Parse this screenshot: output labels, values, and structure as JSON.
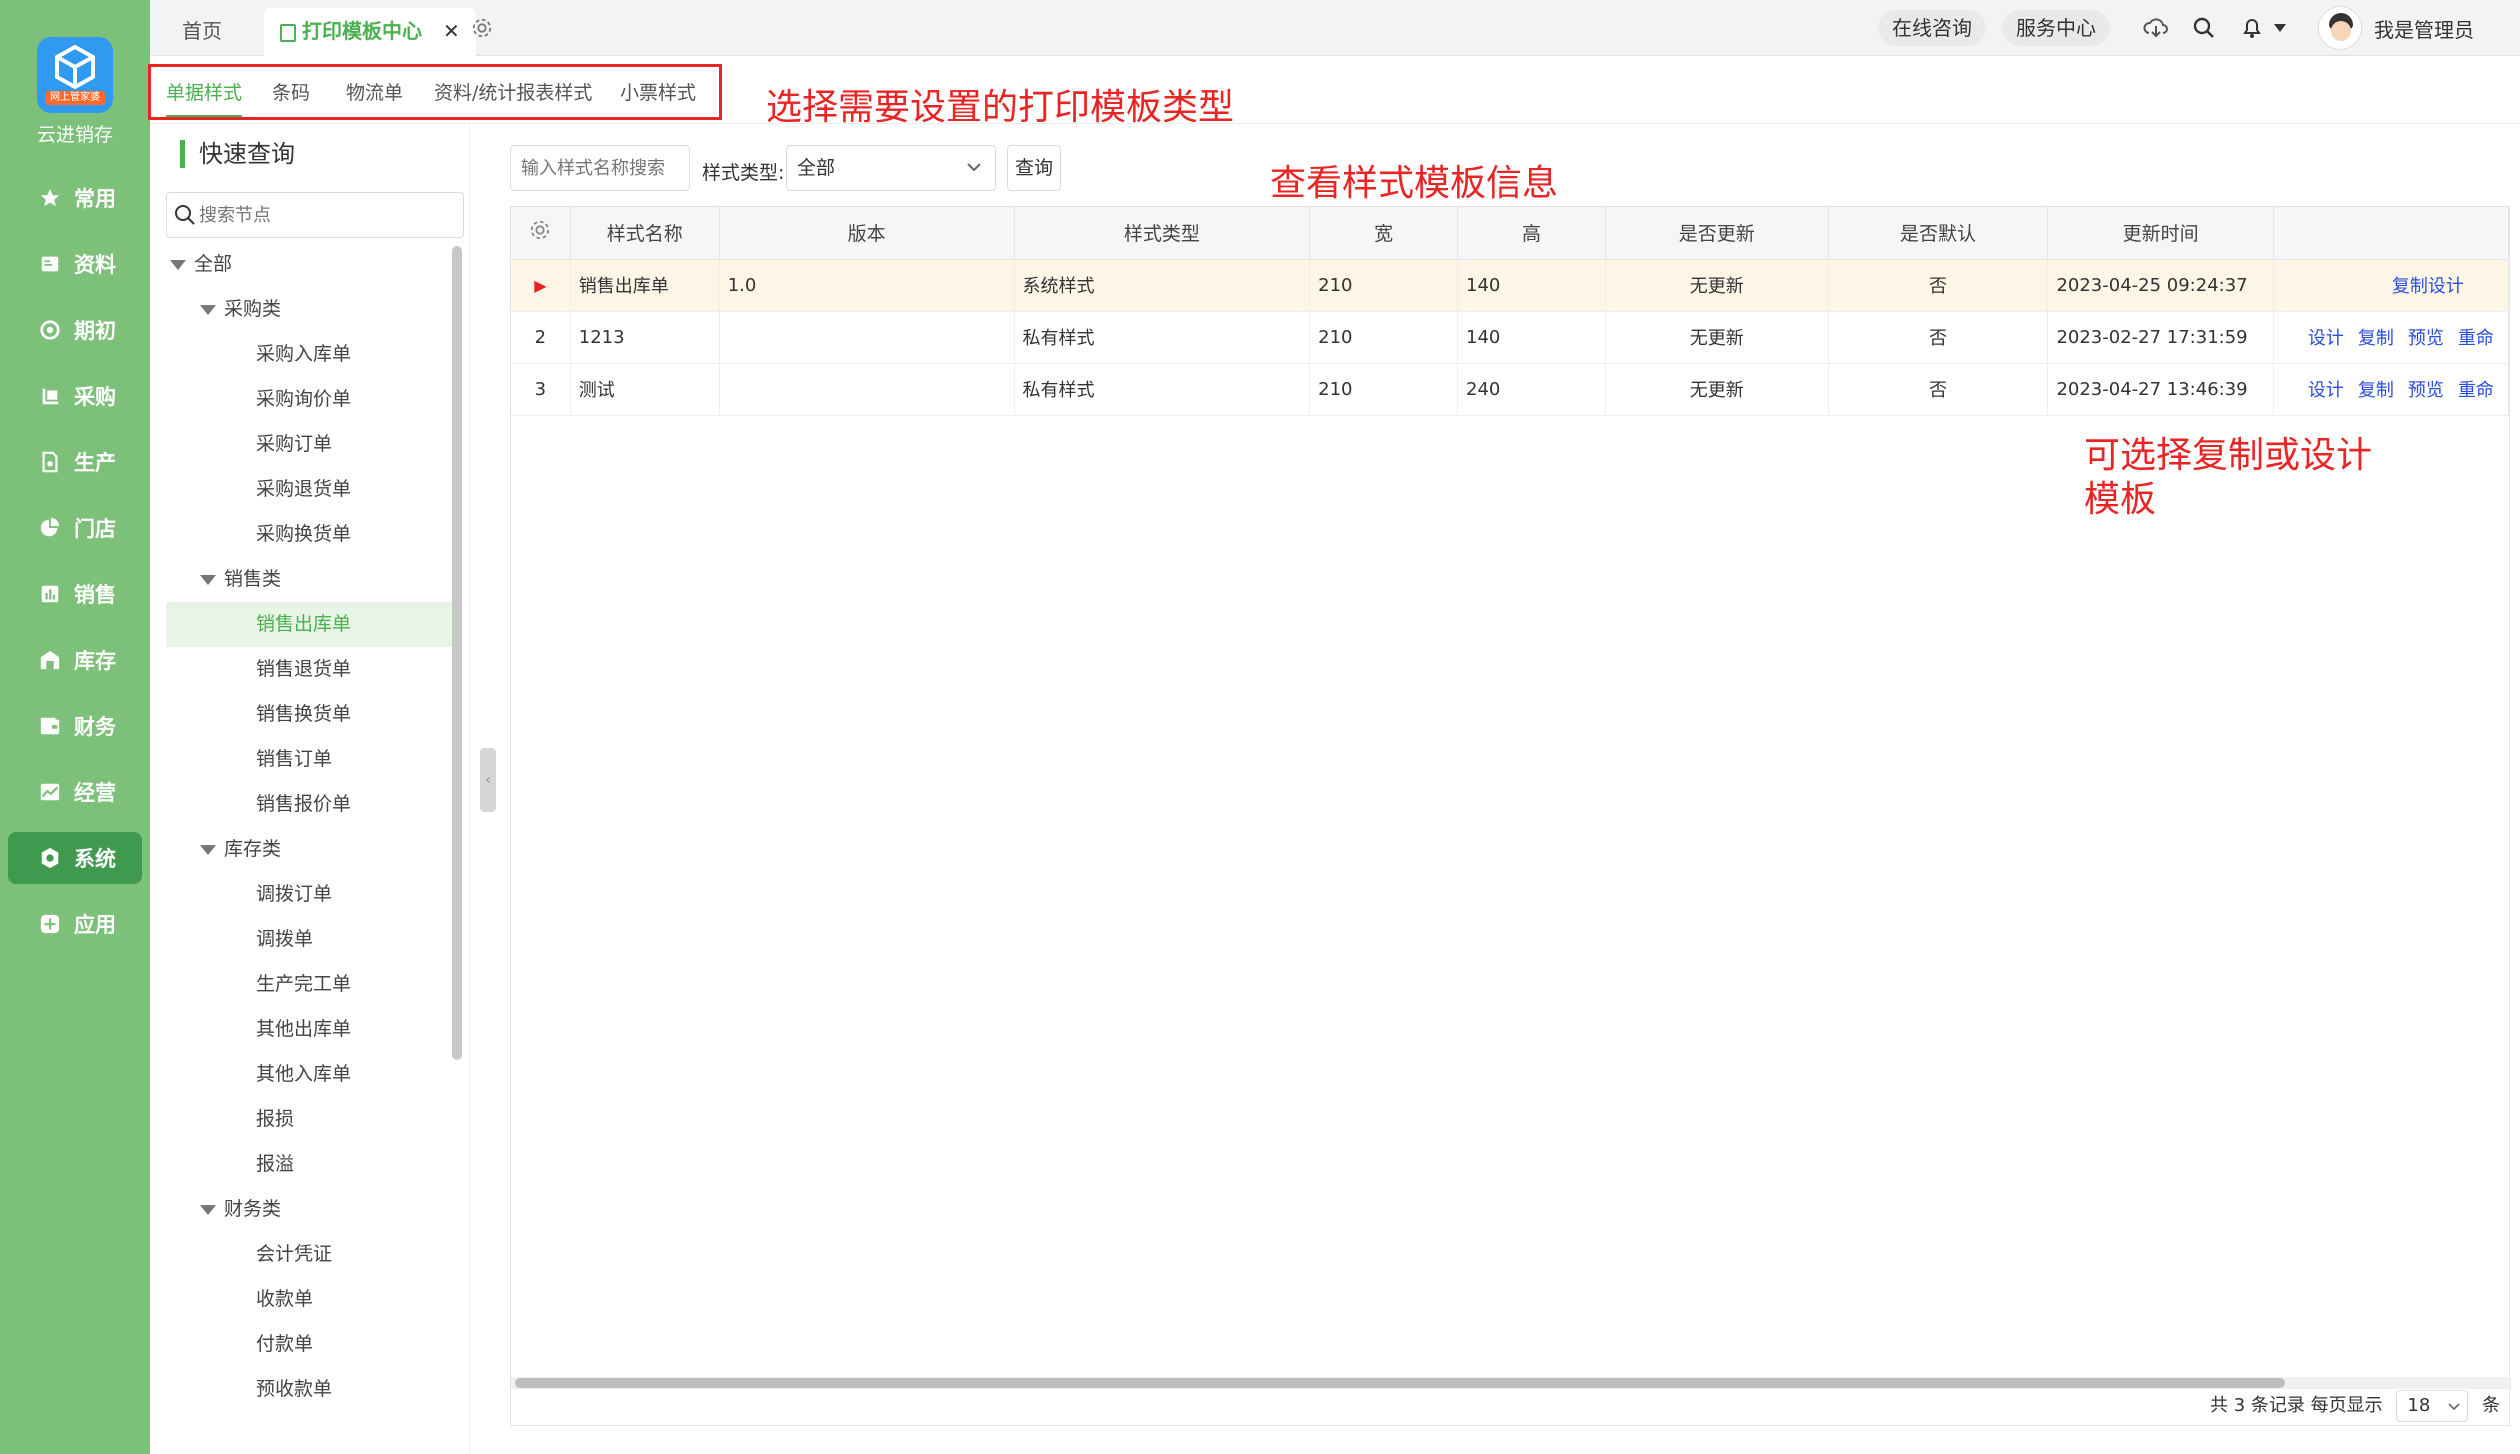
{
  "brand": {
    "name": "云进销存",
    "logo_tag": "网上管家婆"
  },
  "nav": [
    {
      "label": "常用",
      "icon": "star-icon"
    },
    {
      "label": "资料",
      "icon": "id-card-icon"
    },
    {
      "label": "期初",
      "icon": "target-icon"
    },
    {
      "label": "采购",
      "icon": "cart-icon"
    },
    {
      "label": "生产",
      "icon": "document-gear-icon"
    },
    {
      "label": "门店",
      "icon": "pie-chart-icon"
    },
    {
      "label": "销售",
      "icon": "bar-chart-icon"
    },
    {
      "label": "库存",
      "icon": "warehouse-icon"
    },
    {
      "label": "财务",
      "icon": "wallet-icon"
    },
    {
      "label": "经营",
      "icon": "image-chart-icon"
    },
    {
      "label": "系统",
      "icon": "settings-icon"
    },
    {
      "label": "应用",
      "icon": "plus-square-icon"
    }
  ],
  "nav_active": "系统",
  "topbar": {
    "tabs": [
      {
        "label": "首页"
      },
      {
        "label": "打印模板中心"
      }
    ],
    "online": "在线咨询",
    "service": "服务中心",
    "user": "我是管理员"
  },
  "subtabs": [
    "单据样式",
    "条码",
    "物流单",
    "资料/统计报表样式",
    "小票样式"
  ],
  "annotations": {
    "a1": "选择需要设置的打印模板类型",
    "a2": "查看样式模板信息",
    "a3": "可选择复制或设计",
    "a4": "模板"
  },
  "tree": {
    "title": "快速查询",
    "search_placeholder": "搜索节点",
    "nodes": [
      {
        "label": "全部",
        "level": 0,
        "caret": true
      },
      {
        "label": "采购类",
        "level": 1,
        "caret": true
      },
      {
        "label": "采购入库单",
        "level": 2
      },
      {
        "label": "采购询价单",
        "level": 2
      },
      {
        "label": "采购订单",
        "level": 2
      },
      {
        "label": "采购退货单",
        "level": 2
      },
      {
        "label": "采购换货单",
        "level": 2
      },
      {
        "label": "销售类",
        "level": 1,
        "caret": true
      },
      {
        "label": "销售出库单",
        "level": 2,
        "selected": true
      },
      {
        "label": "销售退货单",
        "level": 2
      },
      {
        "label": "销售换货单",
        "level": 2
      },
      {
        "label": "销售订单",
        "level": 2
      },
      {
        "label": "销售报价单",
        "level": 2
      },
      {
        "label": "库存类",
        "level": 1,
        "caret": true
      },
      {
        "label": "调拨订单",
        "level": 2
      },
      {
        "label": "调拨单",
        "level": 2
      },
      {
        "label": "生产完工单",
        "level": 2
      },
      {
        "label": "其他出库单",
        "level": 2
      },
      {
        "label": "其他入库单",
        "level": 2
      },
      {
        "label": "报损",
        "level": 2
      },
      {
        "label": "报溢",
        "level": 2
      },
      {
        "label": "财务类",
        "level": 1,
        "caret": true
      },
      {
        "label": "会计凭证",
        "level": 2
      },
      {
        "label": "收款单",
        "level": 2
      },
      {
        "label": "付款单",
        "level": 2
      },
      {
        "label": "预收款单",
        "level": 2
      }
    ]
  },
  "filter": {
    "name_placeholder": "输入样式名称搜索",
    "type_label": "样式类型:",
    "type_value": "全部",
    "query": "查询"
  },
  "table": {
    "headers": [
      "样式名称",
      "版本",
      "样式类型",
      "宽",
      "高",
      "是否更新",
      "是否默认",
      "更新时间"
    ],
    "rows": [
      {
        "no": "",
        "name": "销售出库单",
        "version": "1.0",
        "type": "系统样式",
        "w": "210",
        "h": "140",
        "update": "无更新",
        "default": "否",
        "time": "2023-04-25 09:24:37",
        "ops": [
          "复制设计"
        ]
      },
      {
        "no": "2",
        "name": "1213",
        "version": "",
        "type": "私有样式",
        "w": "210",
        "h": "140",
        "update": "无更新",
        "default": "否",
        "time": "2023-02-27 17:31:59",
        "ops": [
          "设计",
          "复制",
          "预览",
          "重命"
        ]
      },
      {
        "no": "3",
        "name": "测试",
        "version": "",
        "type": "私有样式",
        "w": "210",
        "h": "240",
        "update": "无更新",
        "default": "否",
        "time": "2023-04-27 13:46:39",
        "ops": [
          "设计",
          "复制",
          "预览",
          "重命"
        ]
      }
    ]
  },
  "pager": {
    "total": "共 3 条记录",
    "per_page_label": "每页显示",
    "per_page": "18",
    "unit": "条"
  },
  "colors": {
    "sidebar": "#7cc07a",
    "accent": "#4caf50",
    "annotation": "#e82424",
    "link": "#2a4ee0"
  }
}
